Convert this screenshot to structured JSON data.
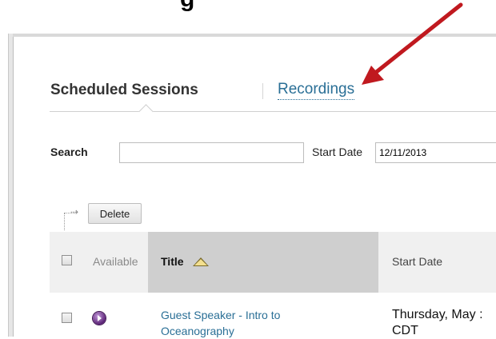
{
  "page": {
    "heading_fragment": "g"
  },
  "tabs": {
    "scheduled": "Scheduled Sessions",
    "recordings": "Recordings"
  },
  "search": {
    "label": "Search",
    "value": "",
    "start_date_label": "Start Date",
    "start_date_value": "12/11/2013"
  },
  "toolbar": {
    "delete_label": "Delete"
  },
  "table": {
    "columns": {
      "available": "Available",
      "title": "Title",
      "start_date": "Start Date"
    },
    "sort": {
      "column": "Title",
      "direction": "ascending"
    },
    "rows": [
      {
        "title_line1": "Guest Speaker - Intro to",
        "title_line2": "Oceanography",
        "start_line1": "Thursday, May :",
        "start_line2": "CDT",
        "available_icon": "purple-arrow-circle-icon"
      }
    ]
  },
  "colors": {
    "link": "#2a6f96",
    "annotation_arrow": "#c0191f",
    "title_header_bg": "#cfcfcf"
  }
}
